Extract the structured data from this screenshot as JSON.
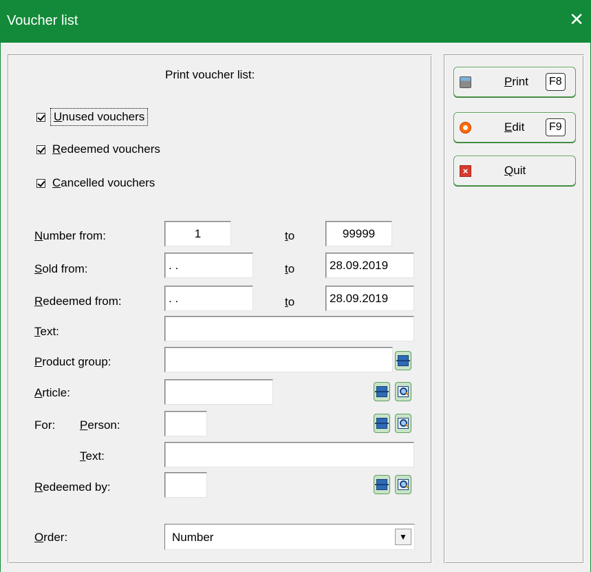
{
  "window": {
    "title": "Voucher list",
    "close_glyph": "✕"
  },
  "heading": "Print voucher list:",
  "checkboxes": [
    {
      "pre": "",
      "ul": "U",
      "post": "nused  vouchers",
      "checked": true
    },
    {
      "pre": "",
      "ul": "R",
      "post": "edeemed vouchers",
      "checked": true
    },
    {
      "pre": "",
      "ul": "C",
      "post": "ancelled vouchers",
      "checked": true
    }
  ],
  "labels": {
    "number_from": {
      "pre": "",
      "ul": "N",
      "post": "umber from:"
    },
    "sold_from": {
      "pre": "",
      "ul": "S",
      "post": "old from:"
    },
    "redeemed_from": {
      "pre": "",
      "ul": "R",
      "post": "edeemed from:"
    },
    "text": {
      "pre": "",
      "ul": "T",
      "post": "ext:"
    },
    "product_group": {
      "pre": "",
      "ul": "P",
      "post": "roduct group:"
    },
    "article": {
      "pre": "",
      "ul": "A",
      "post": "rticle:"
    },
    "for": "For:",
    "person": {
      "pre": "",
      "ul": "P",
      "post": "erson:"
    },
    "for_text": {
      "pre": "",
      "ul": "T",
      "post": "ext:"
    },
    "redeemed_by": {
      "pre": "",
      "ul": "R",
      "post": "edeemed by:"
    },
    "order": {
      "pre": "",
      "ul": "O",
      "post": "rder:"
    },
    "to": {
      "pre": "",
      "ul": "t",
      "post": "o"
    }
  },
  "fields": {
    "number_from": "1",
    "number_to": "99999",
    "sold_from": " . .",
    "sold_to": "28.09.2019",
    "redeemed_from": " . .",
    "redeemed_to": "28.09.2019",
    "text": "",
    "product_group": "",
    "article": "",
    "person": "",
    "for_text": "",
    "redeemed_by": ""
  },
  "order": {
    "selected": "Number",
    "arrow": "▼"
  },
  "buttons": {
    "print": {
      "pre": "",
      "ul": "P",
      "post": "rint",
      "key": "F8",
      "icon": "printer-icon"
    },
    "edit": {
      "pre": "",
      "ul": "E",
      "post": "dit",
      "key": "F9",
      "icon": "edit-circle-icon"
    },
    "quit": {
      "pre": "",
      "ul": "Q",
      "post": "uit",
      "key": "",
      "icon": "quit-x-icon"
    }
  },
  "colors": {
    "titlebar": "#128a39",
    "button_border": "#5ea05e"
  }
}
